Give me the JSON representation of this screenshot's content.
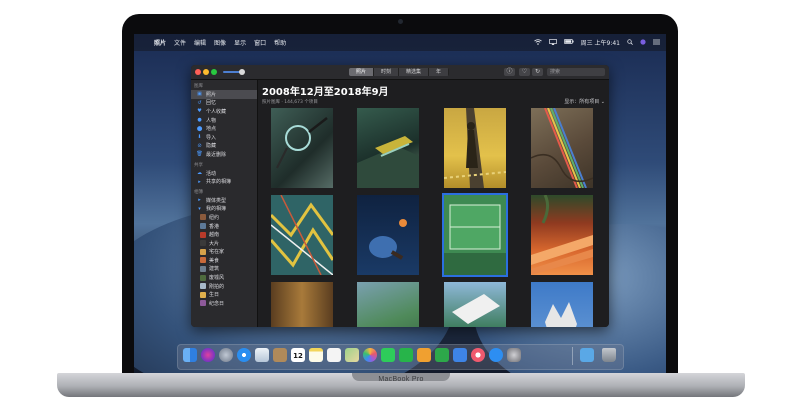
{
  "device": {
    "brand_label": "MacBook Pro"
  },
  "menubar": {
    "apple_icon": "",
    "items": [
      "照片",
      "文件",
      "编辑",
      "图像",
      "显示",
      "窗口",
      "帮助"
    ],
    "status": {
      "clock": "周三 上午9:41"
    }
  },
  "window": {
    "toolbar": {
      "segments": [
        "照片",
        "时刻",
        "精选集",
        "年"
      ],
      "active_segment": "照片",
      "search_placeholder": "搜索"
    },
    "sidebar": {
      "sections": [
        {
          "header": "图库",
          "items": [
            {
              "label": "照片",
              "icon": "photos-icon",
              "selected": true
            },
            {
              "label": "回忆",
              "icon": "memories-icon"
            },
            {
              "label": "个人收藏",
              "icon": "heart-icon"
            },
            {
              "label": "人物",
              "icon": "person-icon"
            },
            {
              "label": "地点",
              "icon": "pin-icon"
            },
            {
              "label": "导入",
              "icon": "import-icon"
            },
            {
              "label": "隐藏",
              "icon": "hidden-icon"
            },
            {
              "label": "最近删除",
              "icon": "trash-icon"
            }
          ]
        },
        {
          "header": "共享",
          "items": [
            {
              "label": "活动",
              "icon": "cloud-icon"
            },
            {
              "label": "共享的相簿",
              "icon": "shared-album-icon"
            }
          ]
        },
        {
          "header": "相簿",
          "items": [
            {
              "label": "媒体类型",
              "icon": "folder-icon"
            },
            {
              "label": "我的相簿",
              "icon": "folder-icon"
            },
            {
              "label": "纽约",
              "icon": "album-thumb",
              "color": "#8b5a3c"
            },
            {
              "label": "香港",
              "icon": "album-thumb",
              "color": "#5d7a9a"
            },
            {
              "label": "越南",
              "icon": "album-thumb",
              "color": "#b73a2a"
            },
            {
              "label": "大片",
              "icon": "album-thumb",
              "color": "#3a3a3a"
            },
            {
              "label": "宅在家",
              "icon": "album-thumb",
              "color": "#d6a24a"
            },
            {
              "label": "美食",
              "icon": "album-thumb",
              "color": "#c96a3a"
            },
            {
              "label": "建筑",
              "icon": "album-thumb",
              "color": "#6e7f8f"
            },
            {
              "label": "废墟风",
              "icon": "album-thumb",
              "color": "#4e6b3e"
            },
            {
              "label": "刚拍的",
              "icon": "album-thumb",
              "color": "#a7b9c9"
            },
            {
              "label": "生日",
              "icon": "album-thumb",
              "color": "#e0b04c"
            },
            {
              "label": "纪念日",
              "icon": "album-thumb",
              "color": "#8e5a9a"
            }
          ]
        }
      ]
    },
    "content": {
      "title": "2008年12月至2018年9月",
      "subtitle": "照片图库 · 144,673 个项目",
      "filter": "显示：所有项目",
      "photos": [
        {
          "name": "photo-glasses"
        },
        {
          "name": "photo-green-stairs"
        },
        {
          "name": "photo-shadow-road"
        },
        {
          "name": "photo-rainbow-wall"
        },
        {
          "name": "photo-zigzag-lines"
        },
        {
          "name": "photo-ping-pong"
        },
        {
          "name": "photo-tennis-court",
          "selected": true
        },
        {
          "name": "photo-orange-steps"
        },
        {
          "name": "photo-brown-texture"
        },
        {
          "name": "photo-green-court"
        },
        {
          "name": "photo-building"
        },
        {
          "name": "photo-statue"
        }
      ]
    }
  },
  "dock": {
    "items": [
      {
        "name": "finder",
        "color": "#3d8ee8"
      },
      {
        "name": "siri",
        "color": "#7a3fd8"
      },
      {
        "name": "launchpad",
        "color": "#8d99a8"
      },
      {
        "name": "safari",
        "color": "#2a8ef0"
      },
      {
        "name": "mail",
        "color": "#dfe6ee"
      },
      {
        "name": "contacts",
        "color": "#b08a5a"
      },
      {
        "name": "calendar",
        "calendar_day": "12",
        "color": "#ffffff"
      },
      {
        "name": "notes",
        "color": "#f3d55a"
      },
      {
        "name": "reminders",
        "color": "#f0f0f0"
      },
      {
        "name": "maps",
        "color": "#6bb86a"
      },
      {
        "name": "photos",
        "color": "#f2b24a"
      },
      {
        "name": "messages",
        "color": "#2ecc5a"
      },
      {
        "name": "facetime",
        "color": "#27b44a"
      },
      {
        "name": "pages",
        "color": "#f0a030"
      },
      {
        "name": "numbers",
        "color": "#2da84a"
      },
      {
        "name": "keynote",
        "color": "#3e84e6"
      },
      {
        "name": "music",
        "color": "#f05a6e"
      },
      {
        "name": "app-store",
        "color": "#2d8ef2"
      },
      {
        "name": "system-preferences",
        "color": "#8e8e93"
      },
      {
        "name": "downloads-folder",
        "color": "#5aa8e6"
      },
      {
        "name": "trash",
        "color": "#9aa0a8"
      }
    ]
  }
}
